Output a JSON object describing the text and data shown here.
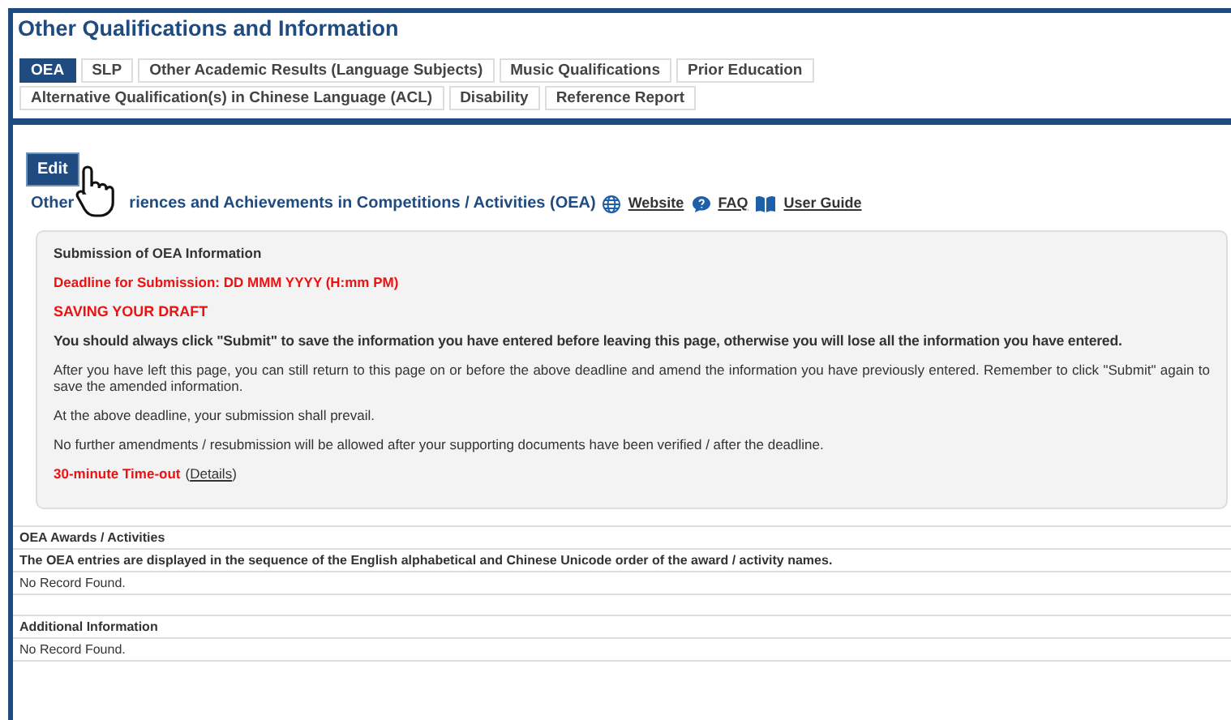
{
  "page": {
    "title": "Other Qualifications and Information"
  },
  "tabs": [
    {
      "label": "OEA",
      "selected": true
    },
    {
      "label": "SLP",
      "selected": false
    },
    {
      "label": "Other Academic Results (Language Subjects)",
      "selected": false
    },
    {
      "label": "Music Qualifications",
      "selected": false
    },
    {
      "label": "Prior Education",
      "selected": false
    },
    {
      "label": "Alternative Qualification(s) in Chinese Language (ACL)",
      "selected": false
    },
    {
      "label": "Disability",
      "selected": false
    },
    {
      "label": "Reference Report",
      "selected": false
    }
  ],
  "edit_button": "Edit",
  "heading": {
    "visible_start": "Other",
    "visible_end": "riences and Achievements in Competitions / Activities (OEA)"
  },
  "links": [
    {
      "kind": "globe",
      "label": "Website"
    },
    {
      "kind": "faq",
      "label": "FAQ"
    },
    {
      "kind": "book",
      "label": "User Guide"
    }
  ],
  "notice": {
    "title": "Submission of OEA Information",
    "deadline": "Deadline for Submission: DD MMM YYYY (H:mm PM)",
    "draft_heading": "SAVING YOUR DRAFT",
    "warning": "You should always click \"Submit\" to save the information you have entered before leaving this page, otherwise you will lose all the information you have entered.",
    "paragraphs": [
      "After you have left this page, you can still return to this page on or before the above deadline and amend the information you have previously entered. Remember to click \"Submit\" again to save the amended information.",
      "At the above deadline, your submission shall prevail.",
      "No further amendments / resubmission will be allowed after your supporting documents have been verified / after the deadline."
    ],
    "timeout": "30-minute Time-out",
    "timeout_open": "(",
    "timeout_link": "Details",
    "timeout_close": ")"
  },
  "sections": [
    {
      "title": "OEA Awards / Activities",
      "note": "The OEA entries are displayed in the sequence of the English alphabetical and Chinese Unicode order of the award / activity names.",
      "empty": "No Record Found."
    },
    {
      "title": "Additional Information",
      "empty": "No Record Found."
    }
  ]
}
